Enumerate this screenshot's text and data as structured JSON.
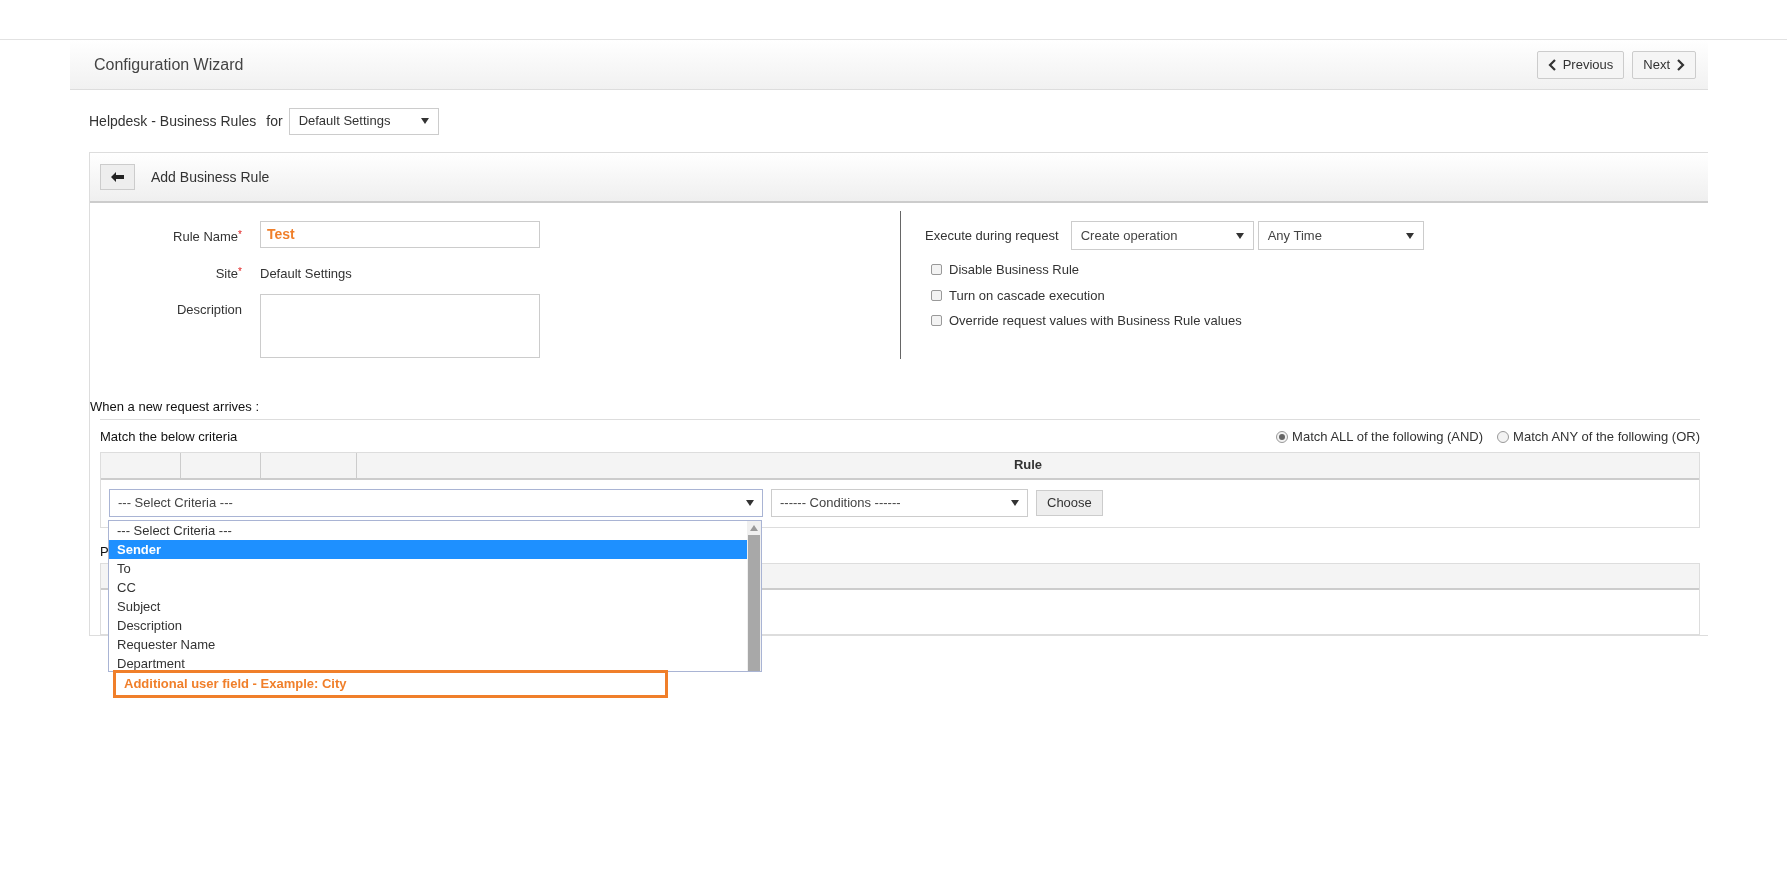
{
  "header": {
    "title": "Configuration Wizard",
    "buttons": [
      {
        "label": "Previous",
        "kind": "previous"
      },
      {
        "label": "Next",
        "kind": "next"
      }
    ]
  },
  "module": {
    "label": "Helpdesk - Business Rules",
    "for_label": "for",
    "select": "Default Settings"
  },
  "panel": {
    "title": "Add Business Rule"
  },
  "form": {
    "fields": [
      {
        "label": "Rule Name",
        "mark": "*",
        "kind": "input",
        "value": "Test"
      },
      {
        "label": "Site",
        "mark": "*",
        "kind": "text",
        "value": "Default Settings"
      },
      {
        "label": "Description",
        "kind": "textarea"
      }
    ]
  },
  "execute": {
    "label": "Execute during request",
    "selects": [
      "Create operation",
      "Any Time"
    ],
    "options": [
      {
        "label": "Disable Business Rule",
        "checked": false
      },
      {
        "label": "Turn on cascade execution",
        "checked": false
      },
      {
        "label": "Override request values with Business Rule values",
        "checked": false
      }
    ]
  },
  "criteria": {
    "heading": "When a new request arrives :",
    "label": "Match the below criteria",
    "match_options": [
      {
        "label": "Match ALL of the following (AND)",
        "selected": true
      },
      {
        "label": "Match ANY of the following (OR)",
        "selected": false
      }
    ],
    "rule_column": "Rule",
    "criteria_select": "--- Select Criteria ---",
    "conditions_select": "------ Conditions ------",
    "choose_button": "Choose",
    "dropdown": {
      "items": [
        {
          "label": "--- Select Criteria ---",
          "selected": false
        },
        {
          "label": "Sender",
          "selected": true
        },
        {
          "label": "To",
          "selected": false
        },
        {
          "label": "CC",
          "selected": false
        },
        {
          "label": "Subject",
          "selected": false
        },
        {
          "label": "Description",
          "selected": false
        },
        {
          "label": "Requester Name",
          "selected": false
        },
        {
          "label": "Department",
          "selected": false
        }
      ]
    }
  },
  "actions": {
    "label": "P"
  },
  "annotation": {
    "text": "Additional user field - Example: City"
  }
}
